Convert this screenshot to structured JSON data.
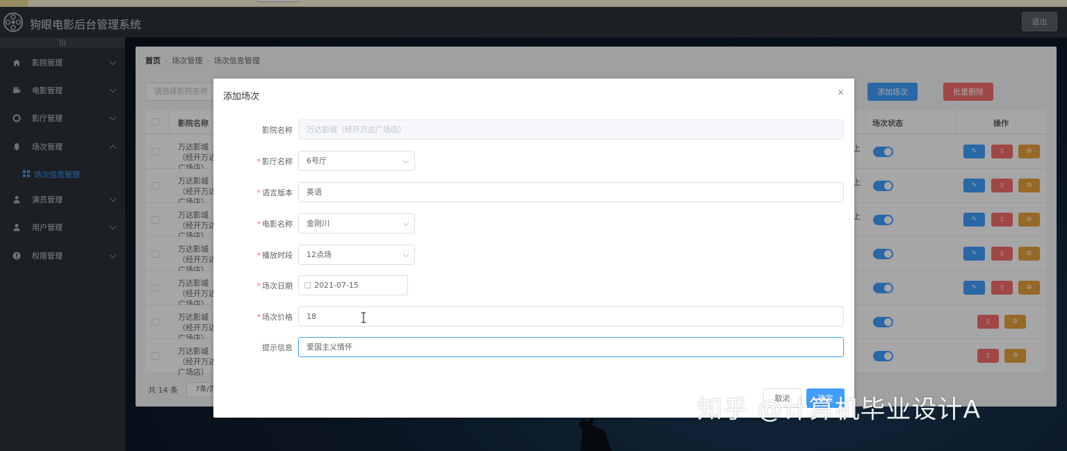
{
  "app": {
    "title": "狗眼电影后台管理系统",
    "logout_label": "退出"
  },
  "sidebar": {
    "collapse_label": "|||",
    "items": [
      {
        "label": "影院管理",
        "icon": "home-icon"
      },
      {
        "label": "电影管理",
        "icon": "film-icon"
      },
      {
        "label": "影厅管理",
        "icon": "circle-icon"
      },
      {
        "label": "场次管理",
        "icon": "bell-icon"
      },
      {
        "label": "演员管理",
        "icon": "user-icon"
      },
      {
        "label": "用户管理",
        "icon": "user-icon"
      },
      {
        "label": "权限管理",
        "icon": "warning-icon"
      }
    ],
    "active_sub": {
      "label": "场次信息管理",
      "icon": "grid-icon"
    }
  },
  "breadcrumb": [
    "首页",
    "场次管理",
    "场次信息管理"
  ],
  "toolbar": {
    "search_placeholder": "请选择影院名称",
    "add_label": "添加场次",
    "batch_delete_label": "批量删除"
  },
  "table": {
    "headers": {
      "name": "影院名称",
      "status": "场次状态",
      "ops": "操作"
    },
    "rows": [
      {
        "name": "万达影城（经开万达广场店）",
        "extra": "上"
      },
      {
        "name": "万达影城（经开万达广场店）",
        "extra": "上"
      },
      {
        "name": "万达影城（经开万达广场店）",
        "extra": "上"
      },
      {
        "name": "万达影城（经开万达广场店）",
        "extra": ""
      },
      {
        "name": "万达影城（经开万达广场店）",
        "extra": ""
      },
      {
        "name": "万达影城（经开万达广场店）",
        "extra": ""
      },
      {
        "name": "万达影城（经开万达广场店）",
        "extra": ""
      }
    ]
  },
  "pager": {
    "total": "共 14 条",
    "size": "7条/页"
  },
  "dialog": {
    "title": "添加场次",
    "close": "×",
    "fields": [
      {
        "label": "影院名称",
        "required": false,
        "value": "万达影城（经开万达广场店）"
      },
      {
        "label": "影厅名称",
        "required": true,
        "value": "6号厅"
      },
      {
        "label": "语言版本",
        "required": true,
        "value": "英语"
      },
      {
        "label": "电影名称",
        "required": true,
        "value": "金刚川"
      },
      {
        "label": "播放时段",
        "required": true,
        "value": "12点场"
      },
      {
        "label": "场次日期",
        "required": true,
        "value": "2021-07-15"
      },
      {
        "label": "场次价格",
        "required": true,
        "value": "18"
      },
      {
        "label": "提示信息",
        "required": false,
        "value": "爱国主义情怀"
      }
    ],
    "cancel_label": "取消",
    "ok_label": "确定"
  },
  "watermark": "知乎 @计算机毕业设计A",
  "colors": {
    "primary": "#409eff",
    "danger": "#f56c6c",
    "warning": "#e6a23c",
    "sidebar": "#2b3138"
  }
}
